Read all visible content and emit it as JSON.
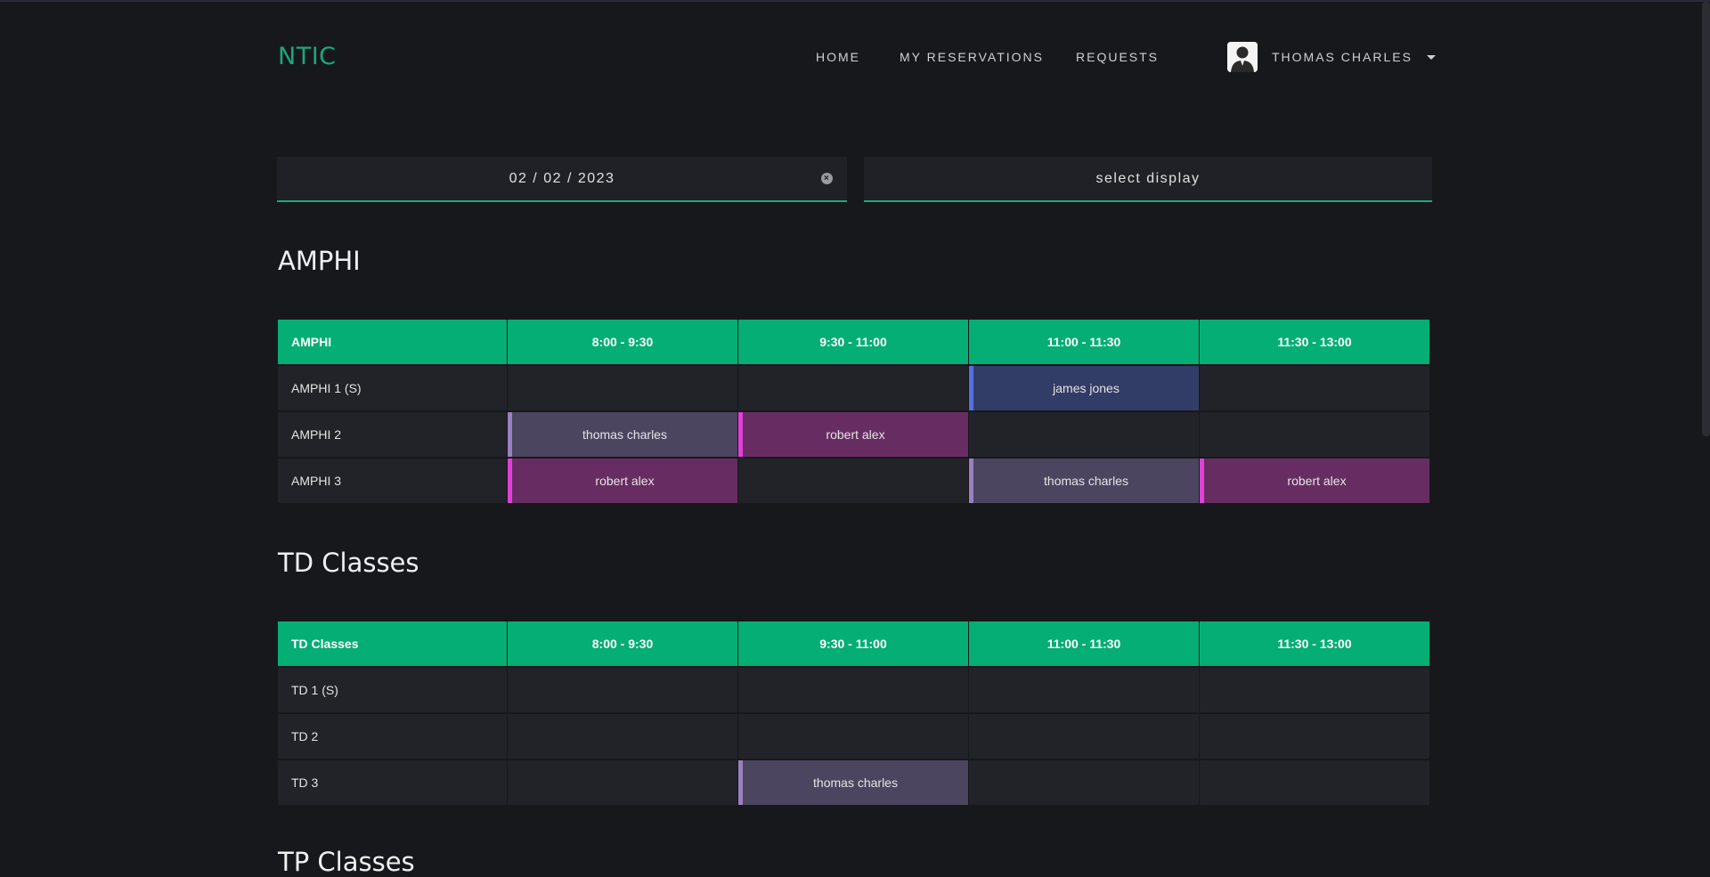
{
  "header": {
    "logo": "NTIC",
    "nav": [
      "HOME",
      "MY RESERVATIONS",
      "REQUESTS"
    ],
    "user_name": "THOMAS CHARLES"
  },
  "filters": {
    "date_value": "02 / 02 / 2023",
    "display_select": "select display"
  },
  "sections": [
    {
      "title": "AMPHI",
      "columns": [
        "AMPHI",
        "8:00 - 9:30",
        "9:30 - 11:00",
        "11:00 - 11:30",
        "11:30 - 13:00"
      ],
      "rows": [
        {
          "name": "AMPHI 1 (S)",
          "slots": [
            "",
            "",
            "james jones",
            ""
          ]
        },
        {
          "name": "AMPHI 2",
          "slots": [
            "thomas charles",
            "robert alex",
            "",
            ""
          ]
        },
        {
          "name": "AMPHI 3",
          "slots": [
            "robert alex",
            "",
            "thomas charles",
            "robert alex"
          ]
        }
      ]
    },
    {
      "title": "TD Classes",
      "columns": [
        "TD Classes",
        "8:00 - 9:30",
        "9:30 - 11:00",
        "11:00 - 11:30",
        "11:30 - 13:00"
      ],
      "rows": [
        {
          "name": "TD 1 (S)",
          "slots": [
            "",
            "",
            "",
            ""
          ]
        },
        {
          "name": "TD 2",
          "slots": [
            "",
            "",
            "",
            ""
          ]
        },
        {
          "name": "TD 3",
          "slots": [
            "",
            "thomas charles",
            "",
            ""
          ]
        }
      ]
    }
  ],
  "partial_section_title": "TP Classes",
  "colors": {
    "accent": "#04ae74",
    "thomas_charles": "#4b4560",
    "robert_alex": "#672d62",
    "james_jones": "#313d66"
  }
}
